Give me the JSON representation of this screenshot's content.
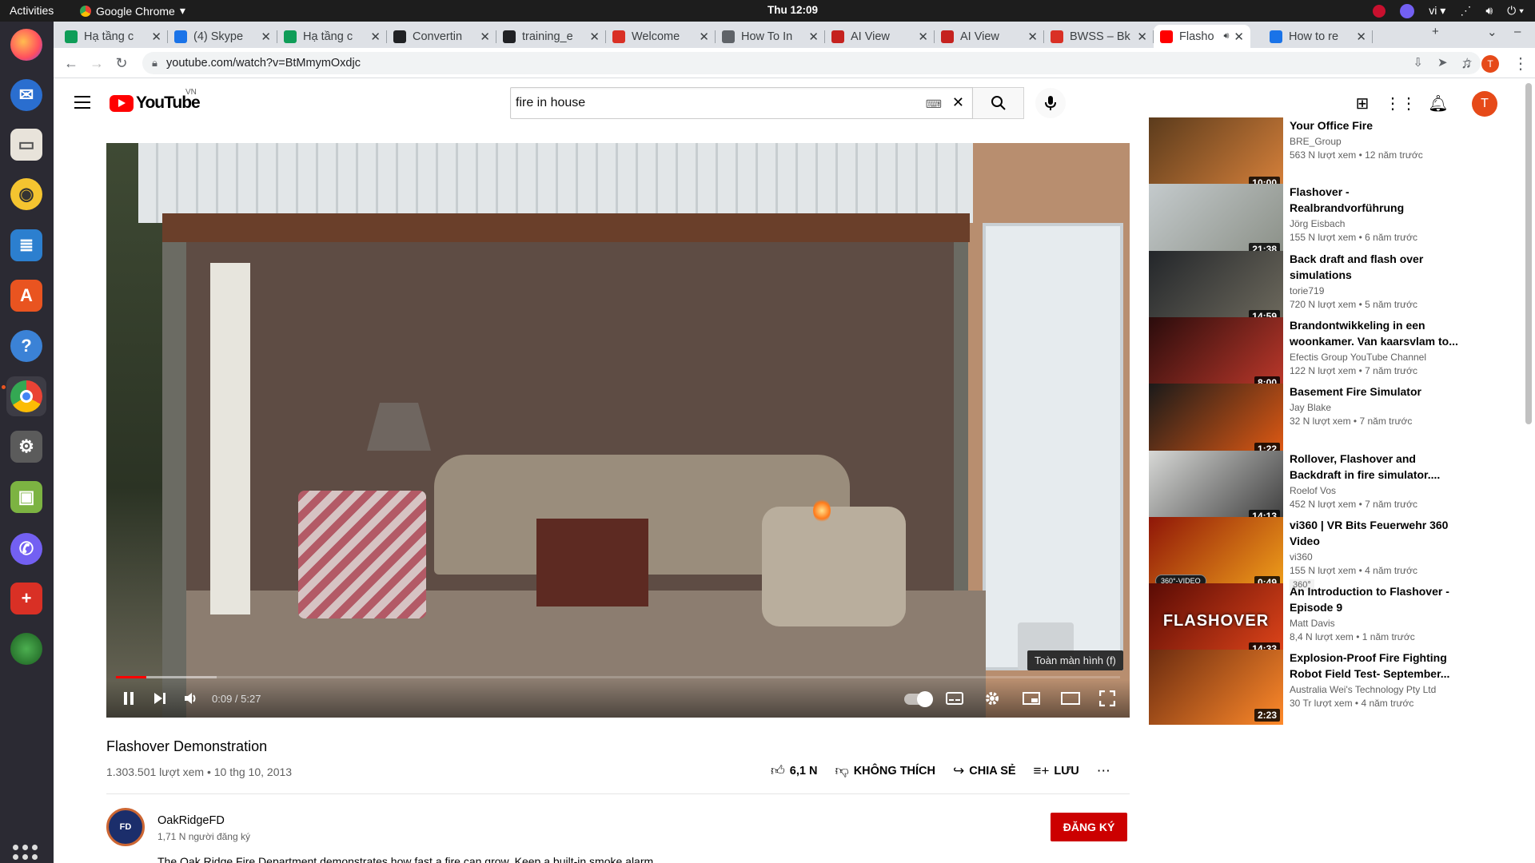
{
  "os": {
    "activities": "Activities",
    "app_name": "Google Chrome",
    "clock": "Thu 12:09",
    "lang": "vi"
  },
  "browser": {
    "tabs": [
      {
        "title": "Hạ tầng c",
        "color": "#0f9d58"
      },
      {
        "title": "(4) Skype",
        "color": "#1a73e8"
      },
      {
        "title": "Hạ tầng c",
        "color": "#0f9d58"
      },
      {
        "title": "Convertin",
        "color": "#202124"
      },
      {
        "title": "training_e",
        "color": "#202124"
      },
      {
        "title": "Welcome",
        "color": "#d93025"
      },
      {
        "title": "How To In",
        "color": "#5f6368"
      },
      {
        "title": "AI View",
        "color": "#c5221f"
      },
      {
        "title": "AI View",
        "color": "#c5221f"
      },
      {
        "title": "BWSS – Bk",
        "color": "#d93025"
      },
      {
        "title": "Flasho",
        "color": "#ff0000"
      },
      {
        "title": "How to re",
        "color": "#1a73e8"
      }
    ],
    "url": "youtube.com/watch?v=BtMmymOxdjc",
    "profile_initial": "T"
  },
  "youtube": {
    "logo_text": "YouTube",
    "logo_country": "VN",
    "search_query": "fire in house",
    "avatar_initial": "T",
    "player": {
      "time": "0:09 / 5:27",
      "progress_played": 0.03,
      "progress_buffered": 0.1,
      "tooltip": "Toàn màn hình (f)"
    },
    "video": {
      "title": "Flashover Demonstration",
      "meta": "1.303.501 lượt xem • 10 thg 10, 2013",
      "likes": "6,1 N",
      "dislike": "KHÔNG THÍCH",
      "share": "CHIA SẺ",
      "save": "LƯU"
    },
    "channel": {
      "name": "OakRidgeFD",
      "subs": "1,71 N người đăng ký",
      "subscribe": "ĐĂNG KÝ",
      "avatar_text": "FD",
      "desc": "The Oak Ridge Fire Department demonstrates how fast a fire can grow. Keep a built-in smoke alarm."
    },
    "recommendations": [
      {
        "title": "Your Office Fire",
        "channel": "BRE_Group",
        "meta": "563 N lượt xem • 12 năm trước",
        "duration": "10:00",
        "colors": [
          "#5b3b1c",
          "#d9823b"
        ]
      },
      {
        "title": "Flashover - Realbrandvorführung",
        "channel": "Jörg Eisbach",
        "meta": "155 N lượt xem • 6 năm trước",
        "duration": "21:38",
        "colors": [
          "#c4cacc",
          "#8a8f86"
        ]
      },
      {
        "title": "Back draft and flash over simulations",
        "channel": "torie719",
        "meta": "720 N lượt xem • 5 năm trước",
        "duration": "14:59",
        "colors": [
          "#23262a",
          "#6f6b5e"
        ]
      },
      {
        "title": "Brandontwikkeling in een woonkamer. Van kaarsvlam to...",
        "channel": "Efectis Group YouTube Channel",
        "meta": "122 N lượt xem • 7 năm trước",
        "duration": "8:00",
        "colors": [
          "#2a0c0c",
          "#c0392b"
        ]
      },
      {
        "title": "Basement Fire Simulator",
        "channel": "Jay Blake",
        "meta": "32 N lượt xem • 7 năm trước",
        "duration": "1:22",
        "colors": [
          "#1a1a1a",
          "#e55b13"
        ]
      },
      {
        "title": "Rollover, Flashover and Backdraft in fire simulator....",
        "channel": "Roelof Vos",
        "meta": "452 N lượt xem • 7 năm trước",
        "duration": "14:13",
        "colors": [
          "#d7d8d6",
          "#3a3a3a"
        ]
      },
      {
        "title": "vi360 | VR Bits Feuerwehr 360 Video",
        "channel": "vi360",
        "meta": "155 N lượt xem • 4 năm trước",
        "duration": "0:49",
        "colors": [
          "#8f1608",
          "#f2a21b"
        ],
        "tag": "360°",
        "badge": "360°-VIDEO"
      },
      {
        "title": "An Introduction to Flashover - Episode 9",
        "channel": "Matt Davis",
        "meta": "8,4 N lượt xem • 1 năm trước",
        "duration": "14:33",
        "colors": [
          "#5a0b05",
          "#e2461a"
        ],
        "overlay": "FLASHOVER"
      },
      {
        "title": "Explosion-Proof Fire Fighting Robot Field Test- September...",
        "channel": "Australia Wei's Technology Pty Ltd",
        "meta": "30 Tr lượt xem • 4 năm trước",
        "duration": "2:23",
        "colors": [
          "#6b2b10",
          "#ff8a2a"
        ]
      }
    ]
  }
}
